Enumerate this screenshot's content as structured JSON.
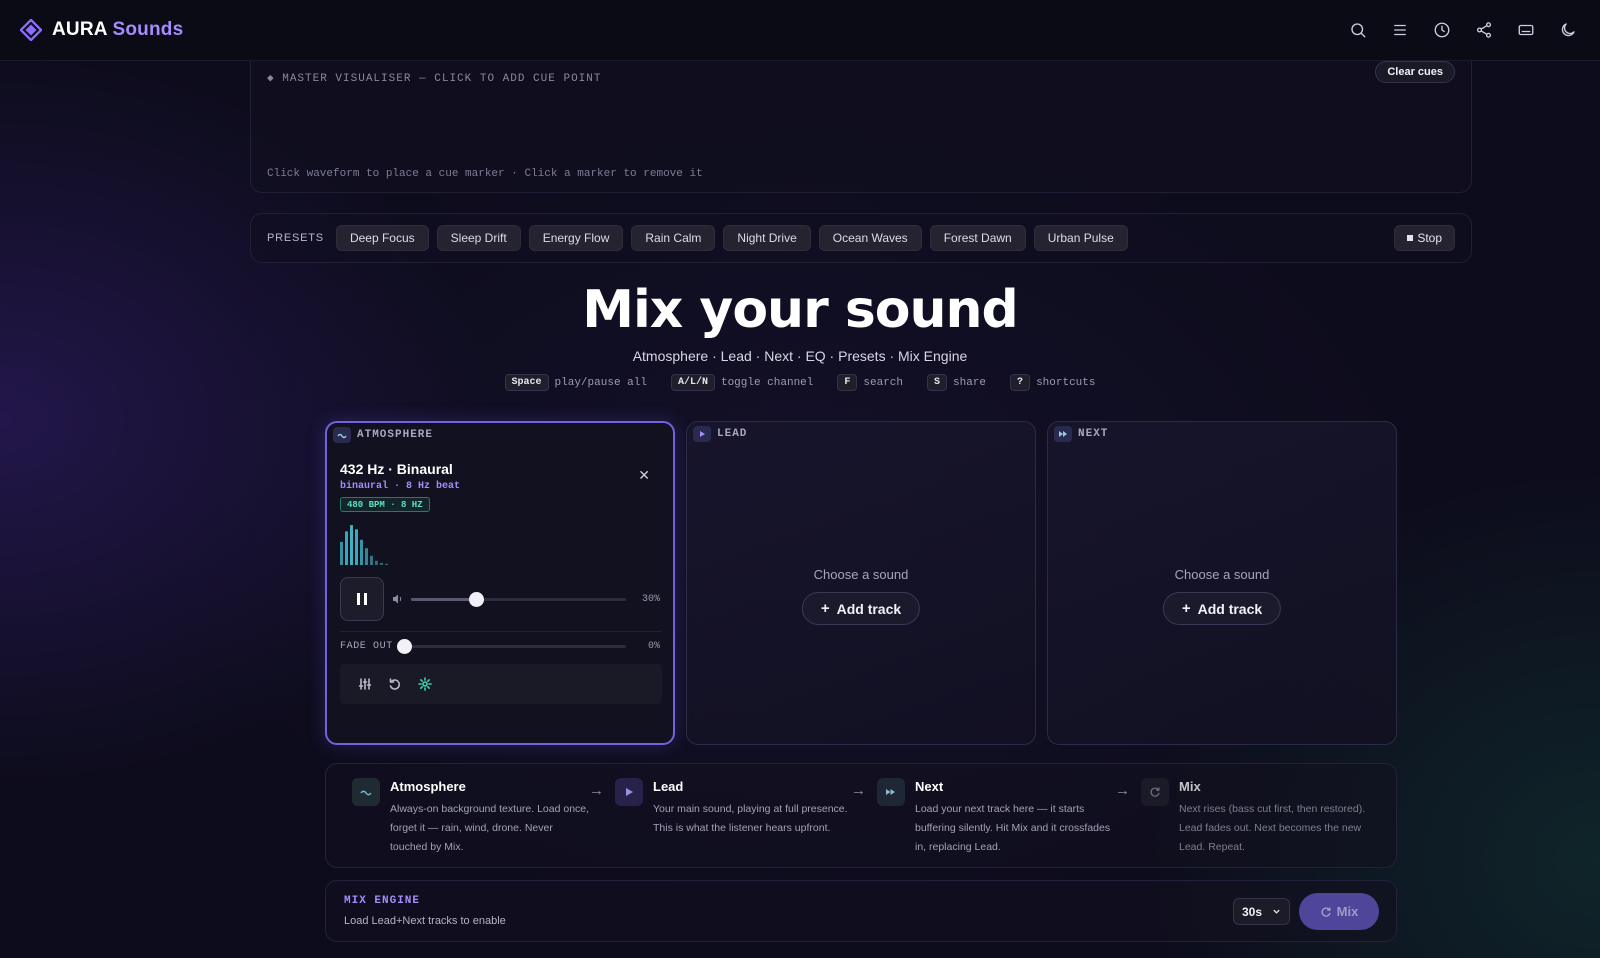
{
  "app": {
    "name_part1": "AURA",
    "name_part2": "Sounds"
  },
  "topbar": {
    "icons": [
      "search-icon",
      "menu-icon",
      "history-icon",
      "share-icon",
      "keyboard-icon",
      "moon-icon"
    ]
  },
  "visualiser": {
    "title": "◆ MASTER VISUALISER — CLICK TO ADD CUE POINT",
    "hint": "Click waveform to place a cue marker · Click a marker to remove it",
    "clear_label": "Clear cues"
  },
  "presets": {
    "label": "PRESETS",
    "items": [
      "Deep Focus",
      "Sleep Drift",
      "Energy Flow",
      "Rain Calm",
      "Night Drive",
      "Ocean Waves",
      "Forest Dawn",
      "Urban Pulse"
    ],
    "stop_label": "Stop"
  },
  "hero": {
    "title": "Mix your sound",
    "subtitle": "Atmosphere · Lead · Next · EQ · Presets · Mix Engine",
    "shortcuts": [
      {
        "key": "Space",
        "desc": "play/pause all"
      },
      {
        "key": "A/L/N",
        "desc": "toggle channel"
      },
      {
        "key": "F",
        "desc": "search"
      },
      {
        "key": "S",
        "desc": "share"
      },
      {
        "key": "?",
        "desc": "shortcuts"
      }
    ]
  },
  "channels": {
    "atmosphere": {
      "label": "ATMOSPHERE",
      "track_title": "432 Hz · Binaural",
      "track_sub": "binaural · 8 Hz beat",
      "tag": "480 BPM · 8 HZ",
      "volume": 0.3,
      "volume_text": "30%",
      "fade_label": "FADE OUT",
      "fade": 0,
      "fade_text": "0%",
      "spectrum": [
        0.55,
        0.8,
        0.95,
        0.85,
        0.6,
        0.4,
        0.22,
        0.1,
        0.05,
        0.03
      ],
      "accent": "#3fb6c8"
    },
    "lead": {
      "label": "LEAD",
      "choose": "Choose a sound",
      "add_label": "Add track"
    },
    "next": {
      "label": "NEXT",
      "choose": "Choose a sound",
      "add_label": "Add track"
    }
  },
  "flow": [
    {
      "name": "Atmosphere",
      "desc": "Always-on background texture. Load once, forget it — rain, wind, drone. Never touched by Mix.",
      "icon": "wave-icon"
    },
    {
      "name": "Lead",
      "desc": "Your main sound, playing at full presence. This is what the listener hears upfront.",
      "icon": "play-icon"
    },
    {
      "name": "Next",
      "desc": "Load your next track here — it starts buffering silently. Hit Mix and it crossfades in, replacing Lead.",
      "icon": "skip-icon"
    },
    {
      "name": "Mix",
      "desc": "Next rises (bass cut first, then restored). Lead fades out. Next becomes the new Lead. Repeat.",
      "icon": "refresh-icon"
    }
  ],
  "mix_engine": {
    "title": "MIX ENGINE",
    "subtitle": "Load Lead+Next tracks to enable",
    "duration": "30s",
    "button_label": "Mix"
  },
  "colors": {
    "accent": "#a48cff",
    "teal": "#5fe0c0",
    "background": "#0d0c1c"
  }
}
